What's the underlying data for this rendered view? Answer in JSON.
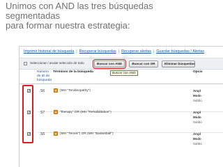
{
  "slide": {
    "title_lines": [
      "Unimos con AND las tres búsquedas",
      "segmentadas",
      "para formar nuestra estrategia:"
    ]
  },
  "menu": {
    "items": [
      "Imprimir historial de búsqueda",
      "Recuperar búsquedas",
      "Recuperar alertas",
      "Guardar búsquedas / Alertas"
    ],
    "separator": "|"
  },
  "toolbar": {
    "select_label": "Seleccionar / anular selección de todo",
    "and_button": "Buscar con AND",
    "or_button": "Buscar con OR",
    "delete_button": "Eliminar búsquedas"
  },
  "tooltip": {
    "text": "Buscar con AND"
  },
  "table": {
    "headers": {
      "number": "Número de ID de búsqueda",
      "terms": "Términos de la búsqueda",
      "options": "Opcio"
    },
    "rows": [
      {
        "checked": true,
        "id": "S6",
        "term": "(MH \"Tendinopathy\")",
        "option_labels": [
          "Ampl",
          "Modo",
          "Subbú"
        ]
      },
      {
        "checked": true,
        "id": "S7",
        "term": "\"therapy\" OR (MH \"Rehabilitation\")",
        "option_labels": [
          "Ampl",
          "Modo",
          "Subbú"
        ]
      },
      {
        "checked": true,
        "id": "S6",
        "term": "(MH \"Tennis\") OR (MH \"Basketball\")",
        "option_labels": [
          "Ampl",
          "Modo",
          "Subbú"
        ]
      }
    ]
  },
  "colors": {
    "highlight": "#d61e1e",
    "link": "#1b4f9c",
    "rss": "#f49b26"
  }
}
